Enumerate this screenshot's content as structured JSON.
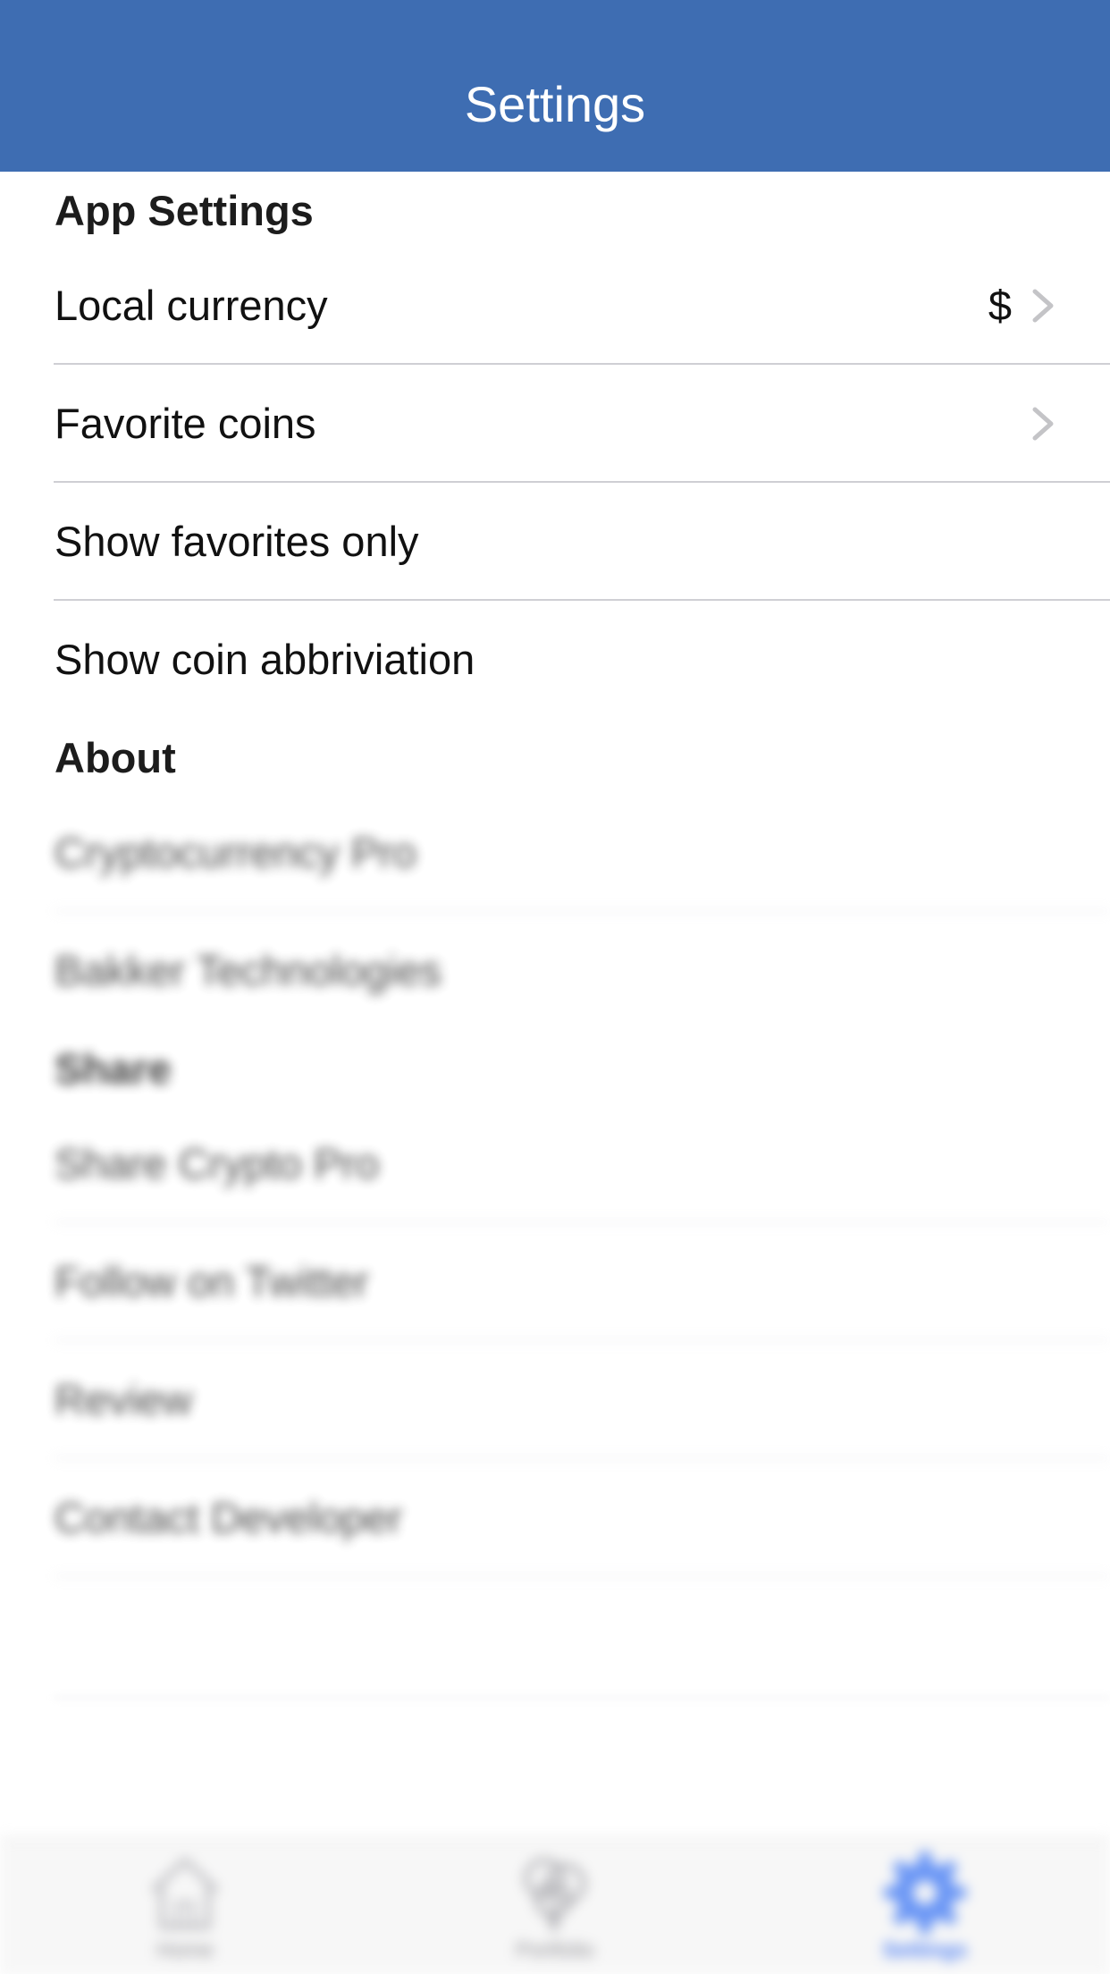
{
  "navbar": {
    "title": "Settings",
    "background_color": "#3e6db2"
  },
  "app_settings": {
    "header": "App Settings",
    "items": [
      {
        "label": "Local currency",
        "value": "$",
        "icon": "chevron-right-icon"
      },
      {
        "label": "Favorite coins",
        "icon": "chevron-right-icon"
      },
      {
        "label": "Show favorites only"
      },
      {
        "label": "Show coin abbriviation"
      }
    ]
  },
  "about": {
    "header": "About",
    "items": [
      {
        "label": "Cryptocurrency Pro"
      },
      {
        "label": "Bakker Technologies"
      }
    ]
  },
  "share": {
    "header": "Share",
    "items": [
      {
        "label": "Share Crypto Pro"
      },
      {
        "label": "Follow on Twitter"
      },
      {
        "label": "Review"
      },
      {
        "label": "Contact Developer"
      }
    ]
  },
  "tabbar": {
    "accent_color": "#4c7ef3",
    "tabs": [
      {
        "label": "Home",
        "icon": "home-icon",
        "active": false
      },
      {
        "label": "Portfolio",
        "icon": "tree-icon",
        "active": false
      },
      {
        "label": "Settings",
        "icon": "gear-icon",
        "active": true
      }
    ]
  }
}
